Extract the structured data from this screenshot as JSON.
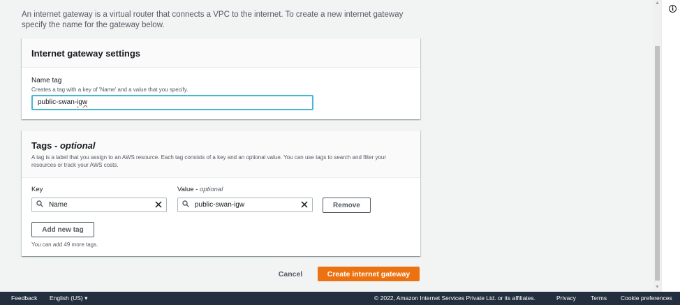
{
  "intro": {
    "description": "An internet gateway is a virtual router that connects a VPC to the internet. To create a new internet gateway specify the name for the gateway below."
  },
  "settings_panel": {
    "title": "Internet gateway settings",
    "name_tag_label": "Name tag",
    "name_tag_description": "Creates a tag with a key of 'Name' and a value that you specify.",
    "name_tag_value_prefix": "public-swan-",
    "name_tag_value_suffix": "igw"
  },
  "tags_panel": {
    "title": "Tags - ",
    "title_optional": "optional",
    "description": "A tag is a label that you assign to an AWS resource. Each tag consists of a key and an optional value. You can use tags to search and filter your resources or track your AWS costs.",
    "key_label": "Key",
    "value_label": "Value - ",
    "value_label_optional": "optional",
    "rows": [
      {
        "key": "Name",
        "value": "public-swan-igw"
      }
    ],
    "remove_label": "Remove",
    "add_label": "Add new tag",
    "remaining_note": "You can add 49 more tags."
  },
  "actions": {
    "cancel_label": "Cancel",
    "create_label": "Create internet gateway"
  },
  "footer": {
    "feedback": "Feedback",
    "language": "English (US) ▾",
    "copyright": "© 2022, Amazon Internet Services Private Ltd. or its affiliates.",
    "privacy": "Privacy",
    "terms": "Terms",
    "cookies": "Cookie preferences"
  },
  "colors": {
    "primary_button": "#ec7211",
    "focus_border": "#44b9d6",
    "footer_bg": "#232f3e"
  },
  "icons": {
    "search": "search-icon",
    "clear": "close-icon",
    "info": "info-icon"
  }
}
